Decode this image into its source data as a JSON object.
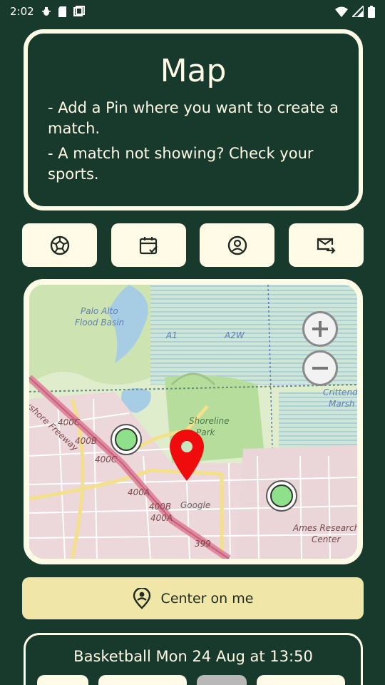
{
  "status_bar": {
    "time": "2:02"
  },
  "info_card": {
    "title": "Map",
    "line1": "- Add a Pin where you want to create a match.",
    "line2": "- A match not showing?   Check your sports."
  },
  "tabs": [
    {
      "icon": "soccer-ball-icon"
    },
    {
      "icon": "calendar-check-icon"
    },
    {
      "icon": "account-circle-icon"
    },
    {
      "icon": "mail-forward-icon"
    }
  ],
  "map": {
    "labels": {
      "palo_alto": "Palo Alto",
      "flood_basin": "Flood Basin",
      "a1": "A1",
      "a2w": "A2W",
      "crittenden": "Crittend",
      "marsh": "Marsh",
      "shoreline": "Shoreline",
      "park": "Park",
      "freeway": "Bayshore Freeway",
      "r400c_1": "400C",
      "r400b_1": "400B",
      "r400c_2": "400C",
      "r400a_1": "400A",
      "r400b_2": "400B",
      "r400a_2": "400A",
      "google": "Google",
      "r399": "399",
      "ames": "Ames Research",
      "center": "Center"
    }
  },
  "center_button": {
    "label": "Center on me"
  },
  "match": {
    "title": "Basketball Mon 24 Aug at 13:50"
  }
}
